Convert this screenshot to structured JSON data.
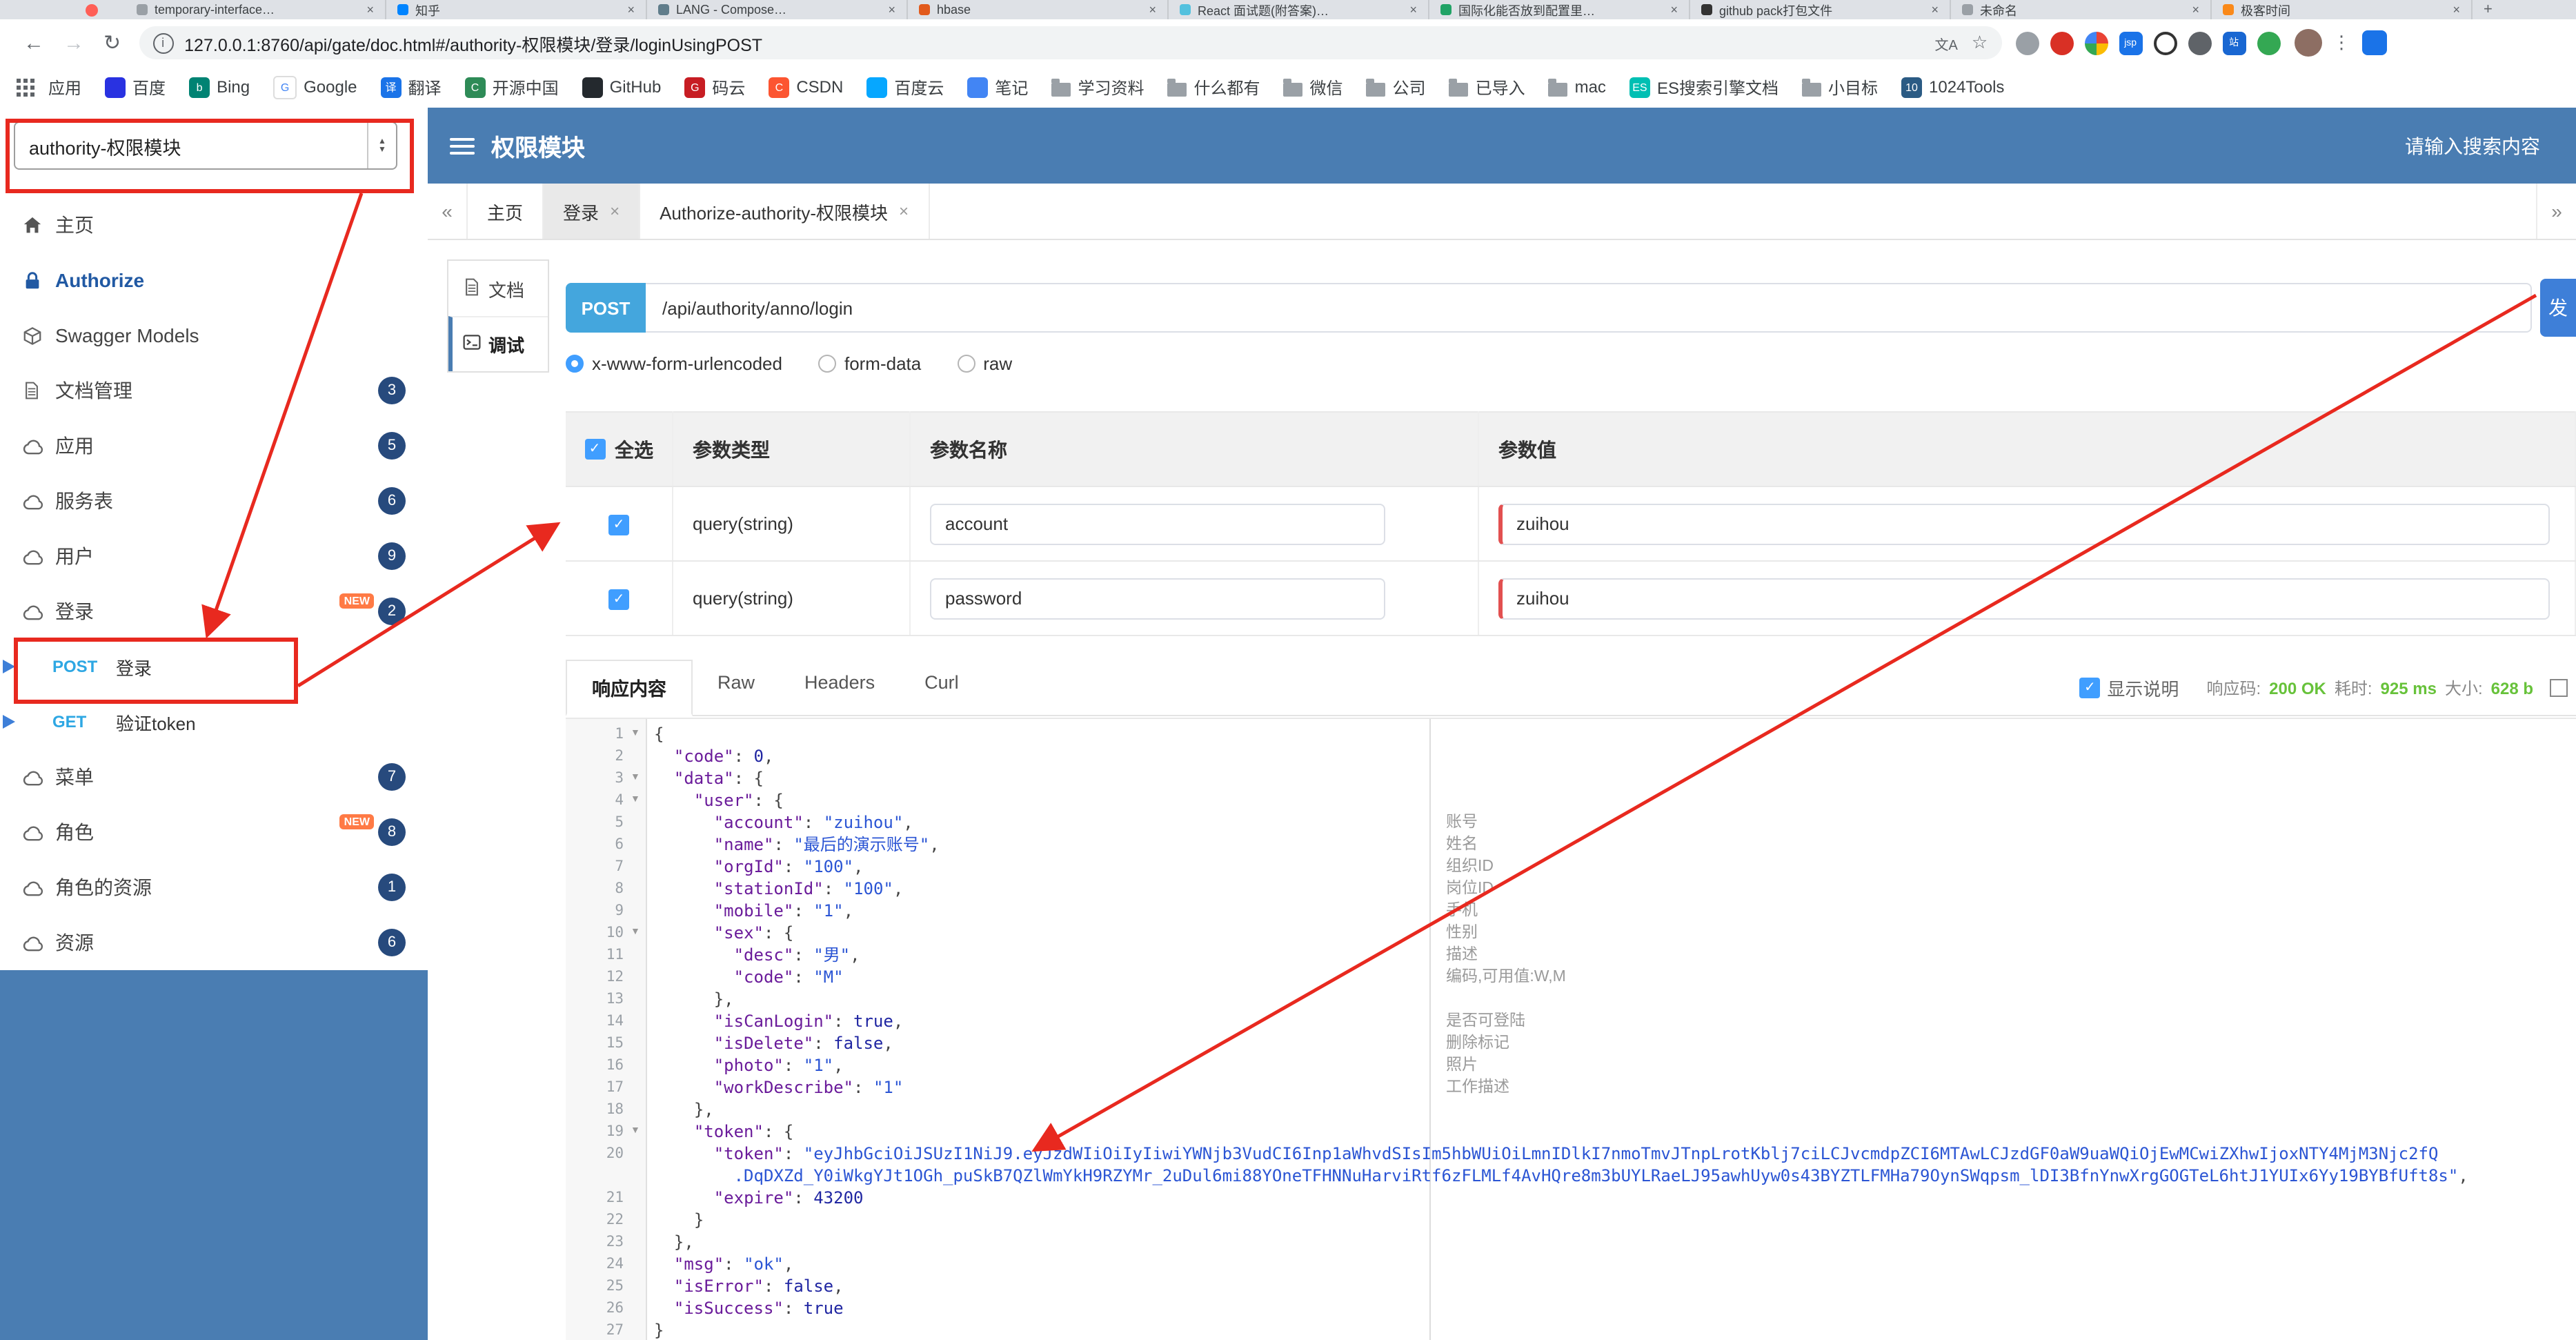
{
  "browser": {
    "new_tab_label": "+",
    "tabs": [
      {
        "title": "temporary-interface…",
        "fav": "#9aa0a6"
      },
      {
        "title": "知乎",
        "fav": "#0084ff"
      },
      {
        "title": "LANG - Compose…",
        "fav": "#607d8b"
      },
      {
        "title": "hbase",
        "fav": "#e25a1c"
      },
      {
        "title": "React 面试题(附答案)…",
        "fav": "#53c1de"
      },
      {
        "title": "国际化能否放到配置里…",
        "fav": "#21a366"
      },
      {
        "title": "github pack打包文件",
        "fav": "#333333"
      },
      {
        "title": "未命名",
        "fav": "#9aa0a6"
      },
      {
        "title": "极客时间",
        "fav": "#fa8919"
      }
    ],
    "toolbar": {
      "back": "←",
      "forward": "→",
      "reload": "↻",
      "url": "127.0.0.1:8760/api/gate/doc.html#/authority-权限模块/登录/loginUsingPOST",
      "translate": "文A",
      "star": "☆",
      "menu": "⋮",
      "ext_icons": [
        {
          "bg": "#9aa0a6"
        },
        {
          "bg": "#d93025"
        },
        {
          "bg": "pinwheel"
        },
        {
          "bg": "#1a73e8",
          "ch": "jsp"
        },
        {
          "bg": "#ffffff",
          "ring": true
        },
        {
          "bg": "#5f6368"
        },
        {
          "bg": "#1967d2",
          "ch": "站"
        },
        {
          "bg": "#34a853"
        }
      ]
    },
    "bookmarks": {
      "apps_label": "应用",
      "items": [
        {
          "label": "百度",
          "bg": "#2932e1"
        },
        {
          "label": "Bing",
          "bg": "#008373",
          "ch": "b"
        },
        {
          "label": "Google",
          "bg": "#ffffff",
          "ch": "G",
          "fg": "#4285f4",
          "border": true
        },
        {
          "label": "翻译",
          "bg": "#1a73e8",
          "ch": "译"
        },
        {
          "label": "开源中国",
          "bg": "#2e8b57",
          "ch": "C"
        },
        {
          "label": "GitHub",
          "bg": "#24292e"
        },
        {
          "label": "码云",
          "bg": "#c71d23",
          "ch": "G"
        },
        {
          "label": "CSDN",
          "bg": "#fc5531",
          "ch": "C"
        },
        {
          "label": "百度云",
          "bg": "#06a7ff"
        },
        {
          "label": "笔记",
          "bg": "#4285f4"
        },
        {
          "label": "学习资料",
          "folder": true
        },
        {
          "label": "什么都有",
          "folder": true
        },
        {
          "label": "微信",
          "folder": true
        },
        {
          "label": "公司",
          "folder": true
        },
        {
          "label": "已导入",
          "folder": true
        },
        {
          "label": "mac",
          "folder": true
        },
        {
          "label": "ES搜索引擎文档",
          "bg": "#00bfb3",
          "ch": "ES"
        },
        {
          "label": "小目标",
          "folder": true
        },
        {
          "label": "1024Tools",
          "bg": "#2b5b84",
          "ch": "10"
        }
      ]
    }
  },
  "header": {
    "group_select": "authority-权限模块",
    "title": "权限模块",
    "search_placeholder": "请输入搜索内容"
  },
  "sidebar": {
    "new_label": "NEW",
    "items": [
      {
        "label": "主页",
        "icon": "house"
      },
      {
        "label": "Authorize",
        "icon": "lock",
        "style": "auth"
      },
      {
        "label": "Swagger Models",
        "icon": "cube"
      },
      {
        "label": "文档管理",
        "icon": "doc",
        "badge": "3"
      },
      {
        "label": "应用",
        "icon": "cloud",
        "badge": "5"
      },
      {
        "label": "服务表",
        "icon": "cloud",
        "badge": "6"
      },
      {
        "label": "用户",
        "icon": "cloud",
        "badge": "9"
      },
      {
        "label": "登录",
        "icon": "cloud",
        "badge": "2",
        "new": true
      },
      {
        "method": "POST",
        "label": "登录",
        "corner": true
      },
      {
        "method": "GET",
        "label": "验证token",
        "corner": true
      },
      {
        "label": "菜单",
        "icon": "cloud",
        "badge": "7"
      },
      {
        "label": "角色",
        "icon": "cloud",
        "badge": "8",
        "new": true
      },
      {
        "label": "角色的资源",
        "icon": "cloud",
        "badge": "1"
      },
      {
        "label": "资源",
        "icon": "cloud",
        "badge": "6"
      }
    ]
  },
  "page_tabs": {
    "back": "«",
    "forward": "»",
    "items": [
      {
        "label": "主页",
        "closable": false,
        "active": false
      },
      {
        "label": "登录",
        "closable": true,
        "active": true
      },
      {
        "label": "Authorize-authority-权限模块",
        "closable": true,
        "active": false
      }
    ]
  },
  "doc_tabs": {
    "items": [
      {
        "label": "文档",
        "icon": "doc",
        "active": false
      },
      {
        "label": "调试",
        "icon": "debug",
        "active": true
      }
    ]
  },
  "request": {
    "method": "POST",
    "path": "/api/authority/anno/login",
    "send_label": "发",
    "content_types": [
      "x-www-form-urlencoded",
      "form-data",
      "raw"
    ],
    "selected_content_type": 0,
    "table": {
      "headers": [
        "全选",
        "参数类型",
        "参数名称",
        "参数值"
      ],
      "rows": [
        {
          "checked": true,
          "type": "query(string)",
          "name": "account",
          "value": "zuihou"
        },
        {
          "checked": true,
          "type": "query(string)",
          "name": "password",
          "value": "zuihou"
        }
      ]
    }
  },
  "response": {
    "tabs": [
      "响应内容",
      "Raw",
      "Headers",
      "Curl"
    ],
    "active_tab": "响应内容",
    "show_desc_label": "显示说明",
    "show_desc_checked": true,
    "meta": [
      {
        "label": "响应码:",
        "value": "200 OK"
      },
      {
        "label": "耗时:",
        "value": "925 ms"
      },
      {
        "label": "大小:",
        "value": "628 b"
      }
    ]
  },
  "editor": {
    "lines": [
      {
        "n": "1",
        "fold": true,
        "s": [
          [
            "pun",
            "{"
          ]
        ]
      },
      {
        "n": "2",
        "s": [
          [
            "w",
            "  "
          ],
          [
            "key",
            "\"code\""
          ],
          [
            "pun",
            ": "
          ],
          [
            "num",
            "0"
          ],
          [
            "pun",
            ","
          ]
        ]
      },
      {
        "n": "3",
        "fold": true,
        "s": [
          [
            "w",
            "  "
          ],
          [
            "key",
            "\"data\""
          ],
          [
            "pun",
            ": {"
          ]
        ]
      },
      {
        "n": "4",
        "fold": true,
        "s": [
          [
            "w",
            "    "
          ],
          [
            "key",
            "\"user\""
          ],
          [
            "pun",
            ": {"
          ]
        ]
      },
      {
        "n": "5",
        "c": "账号",
        "s": [
          [
            "w",
            "      "
          ],
          [
            "key",
            "\"account\""
          ],
          [
            "pun",
            ": "
          ],
          [
            "str",
            "\"zuihou\""
          ],
          [
            "pun",
            ","
          ]
        ]
      },
      {
        "n": "6",
        "c": "姓名",
        "s": [
          [
            "w",
            "      "
          ],
          [
            "key",
            "\"name\""
          ],
          [
            "pun",
            ": "
          ],
          [
            "str",
            "\"最后的演示账号\""
          ],
          [
            "pun",
            ","
          ]
        ]
      },
      {
        "n": "7",
        "c": "组织ID",
        "s": [
          [
            "w",
            "      "
          ],
          [
            "key",
            "\"orgId\""
          ],
          [
            "pun",
            ": "
          ],
          [
            "str",
            "\"100\""
          ],
          [
            "pun",
            ","
          ]
        ]
      },
      {
        "n": "8",
        "c": "岗位ID",
        "s": [
          [
            "w",
            "      "
          ],
          [
            "key",
            "\"stationId\""
          ],
          [
            "pun",
            ": "
          ],
          [
            "str",
            "\"100\""
          ],
          [
            "pun",
            ","
          ]
        ]
      },
      {
        "n": "9",
        "c": "手机",
        "s": [
          [
            "w",
            "      "
          ],
          [
            "key",
            "\"mobile\""
          ],
          [
            "pun",
            ": "
          ],
          [
            "str",
            "\"1\""
          ],
          [
            "pun",
            ","
          ]
        ]
      },
      {
        "n": "10",
        "fold": true,
        "c": "性别",
        "s": [
          [
            "w",
            "      "
          ],
          [
            "key",
            "\"sex\""
          ],
          [
            "pun",
            ": {"
          ]
        ]
      },
      {
        "n": "11",
        "c": "描述",
        "s": [
          [
            "w",
            "        "
          ],
          [
            "key",
            "\"desc\""
          ],
          [
            "pun",
            ": "
          ],
          [
            "str",
            "\"男\""
          ],
          [
            "pun",
            ","
          ]
        ]
      },
      {
        "n": "12",
        "c": "编码,可用值:W,M",
        "s": [
          [
            "w",
            "        "
          ],
          [
            "key",
            "\"code\""
          ],
          [
            "pun",
            ": "
          ],
          [
            "str",
            "\"M\""
          ]
        ]
      },
      {
        "n": "13",
        "s": [
          [
            "w",
            "      "
          ],
          [
            "pun",
            "},"
          ]
        ]
      },
      {
        "n": "14",
        "c": "是否可登陆",
        "s": [
          [
            "w",
            "      "
          ],
          [
            "key",
            "\"isCanLogin\""
          ],
          [
            "pun",
            ": "
          ],
          [
            "bool",
            "true"
          ],
          [
            "pun",
            ","
          ]
        ]
      },
      {
        "n": "15",
        "c": "删除标记",
        "s": [
          [
            "w",
            "      "
          ],
          [
            "key",
            "\"isDelete\""
          ],
          [
            "pun",
            ": "
          ],
          [
            "bool",
            "false"
          ],
          [
            "pun",
            ","
          ]
        ]
      },
      {
        "n": "16",
        "c": "照片",
        "s": [
          [
            "w",
            "      "
          ],
          [
            "key",
            "\"photo\""
          ],
          [
            "pun",
            ": "
          ],
          [
            "str",
            "\"1\""
          ],
          [
            "pun",
            ","
          ]
        ]
      },
      {
        "n": "17",
        "c": "工作描述",
        "s": [
          [
            "w",
            "      "
          ],
          [
            "key",
            "\"workDescribe\""
          ],
          [
            "pun",
            ": "
          ],
          [
            "str",
            "\"1\""
          ]
        ]
      },
      {
        "n": "18",
        "s": [
          [
            "w",
            "    "
          ],
          [
            "pun",
            "},"
          ]
        ]
      },
      {
        "n": "19",
        "fold": true,
        "s": [
          [
            "w",
            "    "
          ],
          [
            "key",
            "\"token\""
          ],
          [
            "pun",
            ": {"
          ]
        ]
      },
      {
        "n": "20",
        "s": [
          [
            "w",
            "      "
          ],
          [
            "key",
            "\"token\""
          ],
          [
            "pun",
            ": "
          ],
          [
            "str",
            "\"eyJhbGciOiJSUzI1NiJ9.eyJzdWIiOiIyIiwiYWNjb3VudCI6Inp1aWhvdSIsIm5hbWUiOiLmnIDlkI7nmoTmvJTnpLrotKblj7ciLCJvcmdpZCI6MTAwLCJzdGF0aW9uaWQiOjEwMCwiZXhwIjoxNTY4MjM3Njc2fQ"
          ]
        ]
      },
      {
        "n": "",
        "s": [
          [
            "w",
            "        "
          ],
          [
            "str",
            ".DqDXZd_Y0iWkgYJt1OGh_puSkB7QZlWmYkH9RZYMr_2uDul6mi88YOneTFHNNuHarviRtf6zFLMLf4AvHQre8m3bUYLRaeLJ95awhUyw0s43BYZTLFMHa79OynSWqpsm_lDI3BfnYnwXrgGOGTeL6htJ1YUIx6Yy19BYBfUft8s\""
          ],
          [
            "pun",
            ","
          ]
        ]
      },
      {
        "n": "21",
        "s": [
          [
            "w",
            "      "
          ],
          [
            "key",
            "\"expire\""
          ],
          [
            "pun",
            ": "
          ],
          [
            "num",
            "43200"
          ]
        ]
      },
      {
        "n": "22",
        "s": [
          [
            "w",
            "    "
          ],
          [
            "pun",
            "}"
          ]
        ]
      },
      {
        "n": "23",
        "s": [
          [
            "w",
            "  "
          ],
          [
            "pun",
            "},"
          ]
        ]
      },
      {
        "n": "24",
        "s": [
          [
            "w",
            "  "
          ],
          [
            "key",
            "\"msg\""
          ],
          [
            "pun",
            ": "
          ],
          [
            "str",
            "\"ok\""
          ],
          [
            "pun",
            ","
          ]
        ]
      },
      {
        "n": "25",
        "s": [
          [
            "w",
            "  "
          ],
          [
            "key",
            "\"isError\""
          ],
          [
            "pun",
            ": "
          ],
          [
            "bool",
            "false"
          ],
          [
            "pun",
            ","
          ]
        ]
      },
      {
        "n": "26",
        "s": [
          [
            "w",
            "  "
          ],
          [
            "key",
            "\"isSuccess\""
          ],
          [
            "pun",
            ": "
          ],
          [
            "bool",
            "true"
          ]
        ]
      },
      {
        "n": "27",
        "s": [
          [
            "pun",
            "}"
          ]
        ]
      }
    ]
  }
}
